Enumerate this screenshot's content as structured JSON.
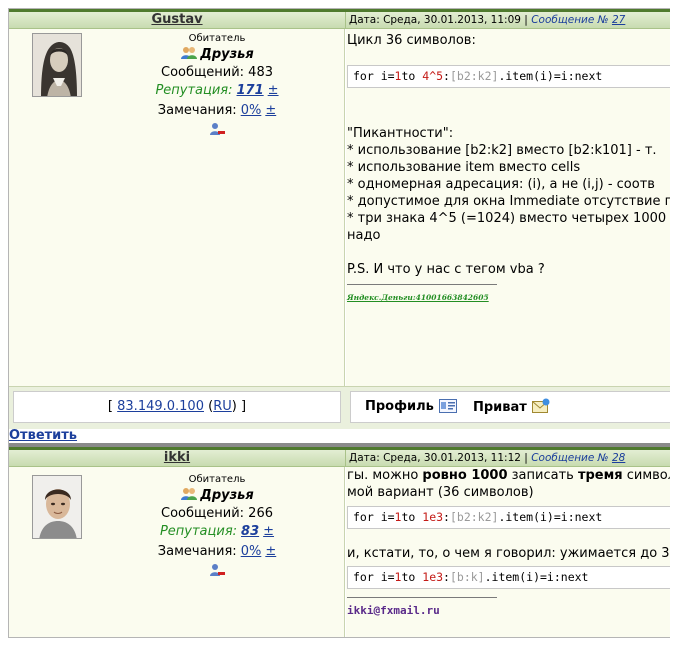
{
  "posts": [
    {
      "username": "Gustav",
      "date": "Дата: Среда, 30.01.2013, 11:09",
      "post_label": "Сообщение №",
      "post_number": "27",
      "rank": "Обитатель",
      "group": "Друзья",
      "messages": "Сообщений: 483",
      "reputation_label": "Репутация:",
      "reputation_value": "171",
      "pm_symbol": "±",
      "warnings_label": "Замечания:",
      "warnings_value": "0%",
      "warnings_pm": "±",
      "body": {
        "line1": "Цикл 36 символов:",
        "code": {
          "a": "for i=",
          "b": "1",
          "c": "to ",
          "d": "4^5",
          "e": ":",
          "f": "[b2:k2]",
          "g": ".item(i)=i:next"
        },
        "lines": [
          "\"Пикантности\":",
          "* использование [b2:k2] вместо [b2:k101] - т.",
          "* использование item вместо cells",
          "* одномерная адресация: (i), а не (i,j) - соотв",
          "* допустимое для окна Immediate отсутствие п",
          "* три знака 4^5 (=1024) вместо четырех 1000",
          "надо"
        ],
        "ps": "P.S. И что у нас с тегом vba ?",
        "signature": "Яндекс.Деньги:41001663842605"
      },
      "ip_open": "[",
      "ip": "83.149.0.100",
      "country": "RU",
      "ip_close": "]",
      "profile_label": "Профиль",
      "private_label": "Приват"
    },
    {
      "username": "ikki",
      "date": "Дата: Среда, 30.01.2013, 11:12",
      "post_label": "Сообщение №",
      "post_number": "28",
      "rank": "Обитатель",
      "group": "Друзья",
      "messages": "Сообщений: 266",
      "reputation_label": "Репутация:",
      "reputation_value": "83",
      "pm_symbol": "±",
      "warnings_label": "Замечания:",
      "warnings_value": "0%",
      "warnings_pm": "±",
      "body": {
        "line1_pre": "гы. можно ",
        "line1_bold1": "ровно 1000",
        "line1_mid": " записать ",
        "line1_bold2": "тремя",
        "line1_post": " символ",
        "line2": "мой вариант (36 символов)",
        "code1": {
          "a": "for i=",
          "b": "1",
          "c": "to ",
          "d": "1e3",
          "e": ":",
          "f": "[b2:k2]",
          "g": ".item(i)=i:next"
        },
        "line3": "и, кстати, то, о чем я говорил: ужимается до 3",
        "code2": {
          "a": "for i=",
          "b": "1",
          "c": "to ",
          "d": "1e3",
          "e": ":",
          "f": "[b:k]",
          "g": ".item(i)=i:next"
        },
        "signature": "ikki@fxmail.ru"
      }
    }
  ],
  "reply_label": "Ответить",
  "colors": {
    "header_green": "#4f7a2e",
    "link_blue": "#1c3f9c",
    "reputation_green": "#238e23",
    "number_red": "#c41a16"
  }
}
